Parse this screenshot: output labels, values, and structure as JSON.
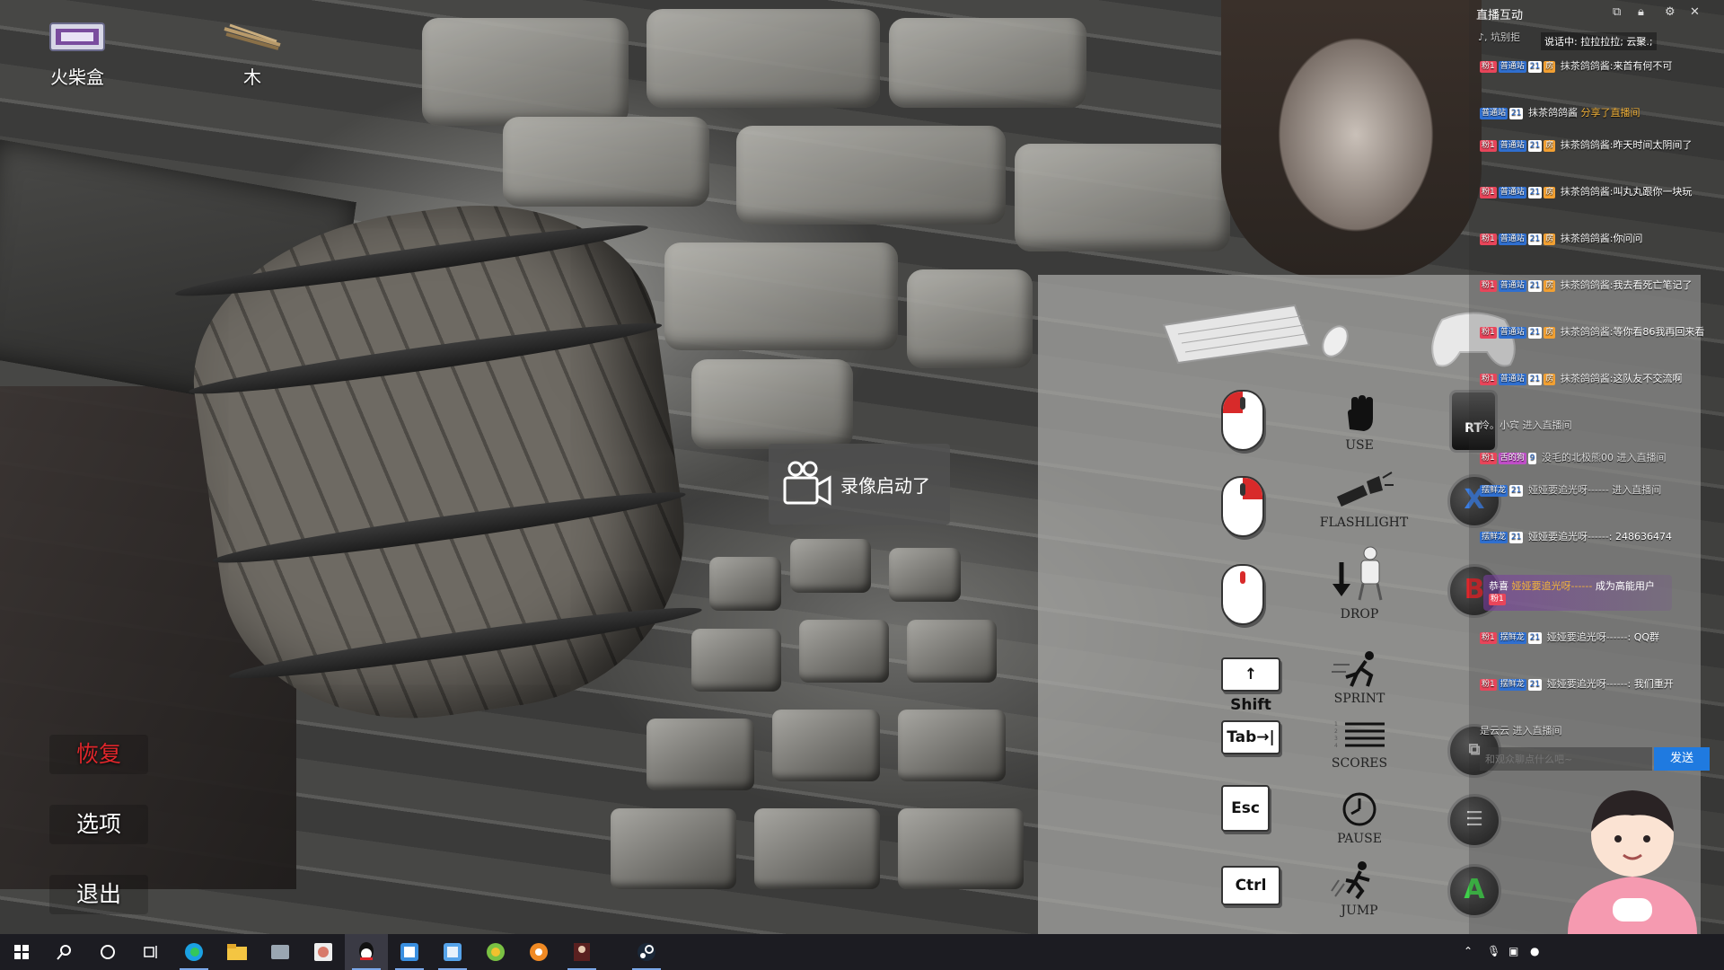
{
  "inventory": [
    {
      "label": "火柴盒",
      "icon": "matchbox-icon"
    },
    {
      "label": "木",
      "icon": "wood-sticks-icon"
    }
  ],
  "pause_menu": {
    "items": [
      {
        "label": "恢复",
        "selected": true
      },
      {
        "label": "选项",
        "selected": false
      },
      {
        "label": "退出",
        "selected": false
      }
    ]
  },
  "toast": {
    "text": "录像启动了",
    "icon": "camera-icon"
  },
  "controls": {
    "mouse_rows": [
      {
        "input": "left-mouse-button",
        "action": "USE",
        "action_icon": "hand-icon"
      },
      {
        "input": "right-mouse-button",
        "action": "FLASHLIGHT",
        "action_icon": "flashlight-icon"
      },
      {
        "input": "middle-mouse-button",
        "action": "DROP",
        "action_icon": "drop-icon"
      }
    ],
    "key_rows": [
      {
        "key": "↑ Shift",
        "action": "SPRINT",
        "action_icon": "sprint-icon"
      },
      {
        "key": "Tab→|",
        "action": "SCORES",
        "action_icon": "scores-icon"
      },
      {
        "key": "Esc",
        "action": "PAUSE",
        "action_icon": "clock-icon"
      },
      {
        "key": "Ctrl",
        "action": "JUMP",
        "action_icon": "jump-icon"
      }
    ],
    "pad_buttons": [
      {
        "label": "RT",
        "color": "#333333"
      },
      {
        "label": "X",
        "color": "#3b7de0"
      },
      {
        "label": "B",
        "color": "#e0262b"
      },
      {
        "label": "",
        "color": "#cccccc"
      },
      {
        "label": "",
        "color": "#cccccc"
      },
      {
        "label": "A",
        "color": "#3fd04a"
      }
    ]
  },
  "chat": {
    "title": "直播互动",
    "speaking": "说话中: 拉拉拉拉; 云聚.;",
    "top_fragment": "♪, 坑别拒",
    "messages": [
      {
        "badges": [
          "粉1",
          "普通站",
          "21",
          "房"
        ],
        "user": "抹茶鸽鸽酱:",
        "text": "来首有何不可",
        "kind": "chat"
      },
      {
        "badges": [
          "普通站",
          "21"
        ],
        "user": "抹茶鸽鸽酱",
        "text": "分享了直播间",
        "kind": "share"
      },
      {
        "badges": [
          "粉1",
          "普通站",
          "21",
          "房"
        ],
        "user": "抹茶鸽鸽酱:",
        "text": "昨天时间太阴间了",
        "kind": "chat"
      },
      {
        "badges": [
          "粉1",
          "普通站",
          "21",
          "房"
        ],
        "user": "抹茶鸽鸽酱:",
        "text": "叫丸丸跟你一块玩",
        "kind": "chat"
      },
      {
        "badges": [
          "粉1",
          "普通站",
          "21",
          "房"
        ],
        "user": "抹茶鸽鸽酱:",
        "text": "你问问",
        "kind": "chat"
      },
      {
        "badges": [
          "粉1",
          "普通站",
          "21",
          "房"
        ],
        "user": "抹茶鸽鸽酱:",
        "text": "我去看死亡笔记了",
        "kind": "chat"
      },
      {
        "badges": [
          "粉1",
          "普通站",
          "21",
          "房"
        ],
        "user": "抹茶鸽鸽酱:",
        "text": "等你看86我再回来看",
        "kind": "chat"
      },
      {
        "badges": [
          "粉1",
          "普通站",
          "21",
          "房"
        ],
        "user": "抹茶鸽鸽酱:",
        "text": "这队友不交流啊",
        "kind": "chat"
      },
      {
        "badges": [],
        "user": "冷。小宾",
        "text": "进入直播间",
        "kind": "enter"
      },
      {
        "badges": [
          "粉1",
          "舌的狗",
          "9"
        ],
        "user": "没毛的北极熊00",
        "text": "进入直播间",
        "kind": "enter"
      },
      {
        "badges": [
          "摆鲜龙",
          "21"
        ],
        "user": "娅娅要追光呀------",
        "text": "进入直播间",
        "kind": "enter"
      },
      {
        "badges": [
          "摆鲜龙",
          "21"
        ],
        "user": "娅娅要追光呀------:",
        "text": "248636474",
        "kind": "chat"
      },
      {
        "badges": [
          "粉1",
          "摆鲜龙",
          "21"
        ],
        "user": "娅娅要追光呀------:",
        "text": "QQ群",
        "kind": "chat"
      },
      {
        "badges": [
          "粉1",
          "摆鲜龙",
          "21"
        ],
        "user": "娅娅要追光呀------:",
        "text": "我们重开",
        "kind": "chat"
      },
      {
        "badges": [],
        "user": "是云云",
        "text": "进入直播间",
        "kind": "enter"
      }
    ],
    "congrats": {
      "prefix": "恭喜",
      "user": "娅娅要追光呀------",
      "text": "成为高能用户",
      "badge": "粉1"
    },
    "input_placeholder": "和观众聊点什么吧~",
    "send_label": "发送"
  },
  "taskbar": {
    "apps": [
      "windows-start-icon",
      "search-icon",
      "cortana-icon",
      "task-view-icon",
      "edge-icon",
      "file-explorer-icon",
      "app-icon",
      "app-icon",
      "qq-icon",
      "app-icon",
      "app-icon",
      "app-icon",
      "app-icon",
      "app-icon",
      "steam-icon"
    ]
  }
}
